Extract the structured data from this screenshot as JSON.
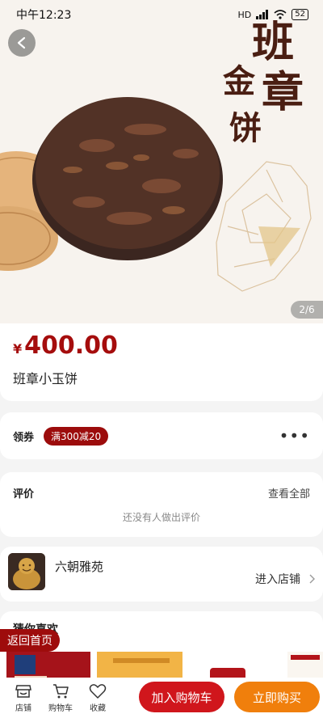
{
  "status_bar": {
    "time": "中午12:23",
    "network": "HD",
    "battery": "52"
  },
  "hero": {
    "image_counter": "2/6",
    "calligraphy_text": "班章金饼",
    "colors": {
      "tea": "#4a2e24",
      "wood": "#e2b27c",
      "background": "#f7f3ee"
    }
  },
  "product": {
    "currency": "¥",
    "price": "400.00",
    "name": "班章小玉饼",
    "price_color": "#a50d0d"
  },
  "coupon": {
    "label": "领券",
    "badge": "满300减20"
  },
  "reviews": {
    "title": "评价",
    "view_all": "查看全部",
    "empty_text": "还没有人做出评价"
  },
  "shop": {
    "name": "六朝雅苑",
    "enter_label": "进入店铺"
  },
  "recommend": {
    "title": "猜你喜欢"
  },
  "floating": {
    "home_label": "返回首页"
  },
  "bottom_bar": {
    "nav": [
      {
        "label": "店铺",
        "icon": "store-icon"
      },
      {
        "label": "购物车",
        "icon": "cart-icon"
      },
      {
        "label": "收藏",
        "icon": "heart-icon"
      }
    ],
    "add_to_cart": "加入购物车",
    "buy_now": "立即购买",
    "cart_color": "#d0161c",
    "buy_color": "#f07f0c"
  }
}
